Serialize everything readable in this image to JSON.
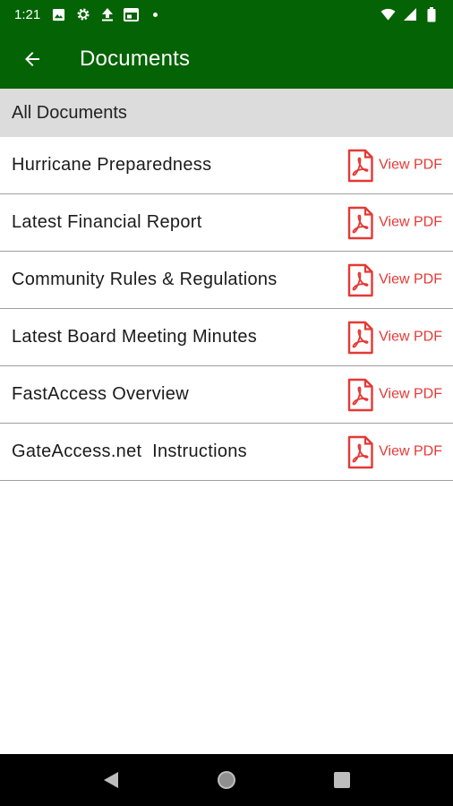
{
  "status_bar": {
    "time": "1:21",
    "left_icons": [
      "image-icon",
      "gear-icon",
      "upload-icon",
      "calendar-icon",
      "dot-icon"
    ],
    "right_icons": [
      "wifi-icon",
      "signal-icon",
      "battery-icon"
    ]
  },
  "app_bar": {
    "back_icon": "arrow-left-icon",
    "title": "Documents"
  },
  "section": {
    "header": "All Documents"
  },
  "documents": [
    {
      "title": "Hurricane Preparedness",
      "action": "View PDF"
    },
    {
      "title": "Latest Financial Report",
      "action": "View PDF"
    },
    {
      "title": "Community Rules & Regulations",
      "action": "View PDF"
    },
    {
      "title": "Latest Board Meeting Minutes",
      "action": "View PDF"
    },
    {
      "title": "FastAccess Overview",
      "action": "View PDF"
    },
    {
      "title": "GateAccess.net  Instructions",
      "action": "View PDF"
    }
  ],
  "nav_bar": {
    "buttons": [
      "back-triangle-icon",
      "home-circle-icon",
      "recents-square-icon"
    ]
  },
  "colors": {
    "primary": "#046304",
    "section_bg": "#dcdcdc",
    "pdf_red": "#e53935",
    "divider": "#9e9e9e"
  }
}
